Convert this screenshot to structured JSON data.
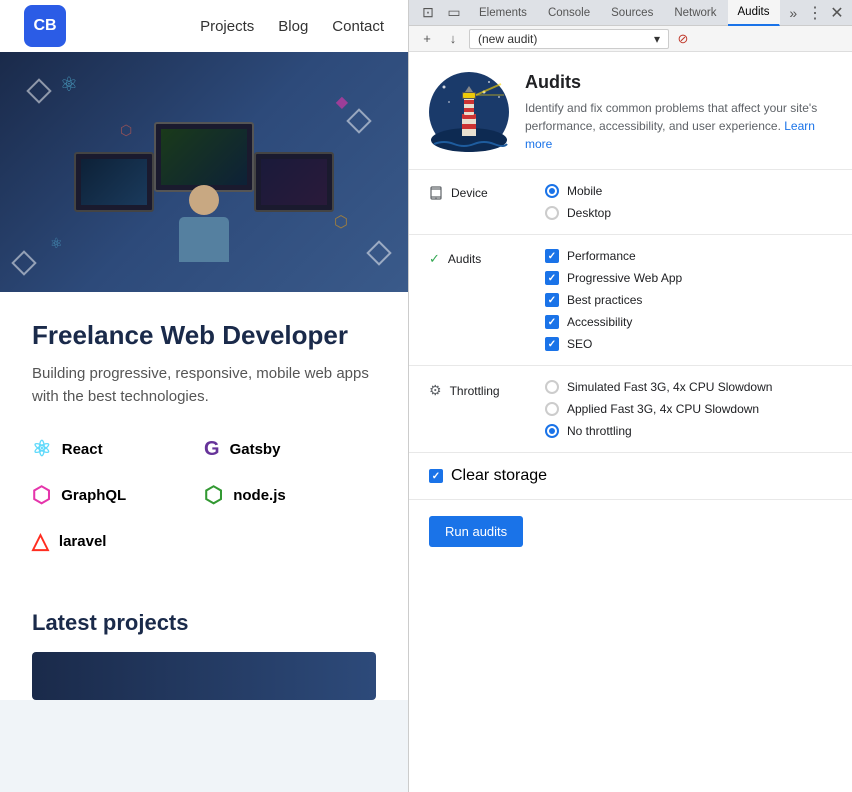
{
  "website": {
    "logo_text": "CB",
    "nav": {
      "links": [
        "Projects",
        "Blog",
        "Contact"
      ]
    },
    "hero": {
      "title": "Freelance Web Developer",
      "subtitle": "Building progressive, responsive, mobile\nweb apps with the best technologies.",
      "tech_items": [
        {
          "name": "React",
          "color": "#61dafb"
        },
        {
          "name": "Gatsby",
          "color": "#663399"
        },
        {
          "name": "GraphQL",
          "color": "#e535ab"
        },
        {
          "name": "node.js",
          "color": "#339933"
        },
        {
          "name": "laravel",
          "color": "#ff2d20"
        }
      ]
    },
    "latest_projects_title": "Latest projects"
  },
  "devtools": {
    "tabs": [
      "Elements",
      "Console",
      "Sources",
      "Network",
      "Audits"
    ],
    "active_tab": "Audits",
    "toolbar": {
      "audit_selector_text": "(new audit)",
      "audit_selector_placeholder": "(new audit)"
    },
    "audits_panel": {
      "title": "Audits",
      "description": "Identify and fix common problems that affect your site's performance, accessibility, and user experience.",
      "learn_more_text": "Learn more",
      "device_section": {
        "label": "Device",
        "options": [
          {
            "label": "Mobile",
            "selected": true
          },
          {
            "label": "Desktop",
            "selected": false
          }
        ]
      },
      "audits_section": {
        "label": "Audits",
        "items": [
          {
            "label": "Performance",
            "checked": true
          },
          {
            "label": "Progressive Web App",
            "checked": true
          },
          {
            "label": "Best practices",
            "checked": true
          },
          {
            "label": "Accessibility",
            "checked": true
          },
          {
            "label": "SEO",
            "checked": true
          }
        ]
      },
      "throttling_section": {
        "label": "Throttling",
        "options": [
          {
            "label": "Simulated Fast 3G, 4x CPU Slowdown",
            "selected": false
          },
          {
            "label": "Applied Fast 3G, 4x CPU Slowdown",
            "selected": false
          },
          {
            "label": "No throttling",
            "selected": true
          }
        ]
      },
      "clear_storage": {
        "label": "Clear storage",
        "checked": true
      },
      "run_button_label": "Run audits"
    }
  }
}
